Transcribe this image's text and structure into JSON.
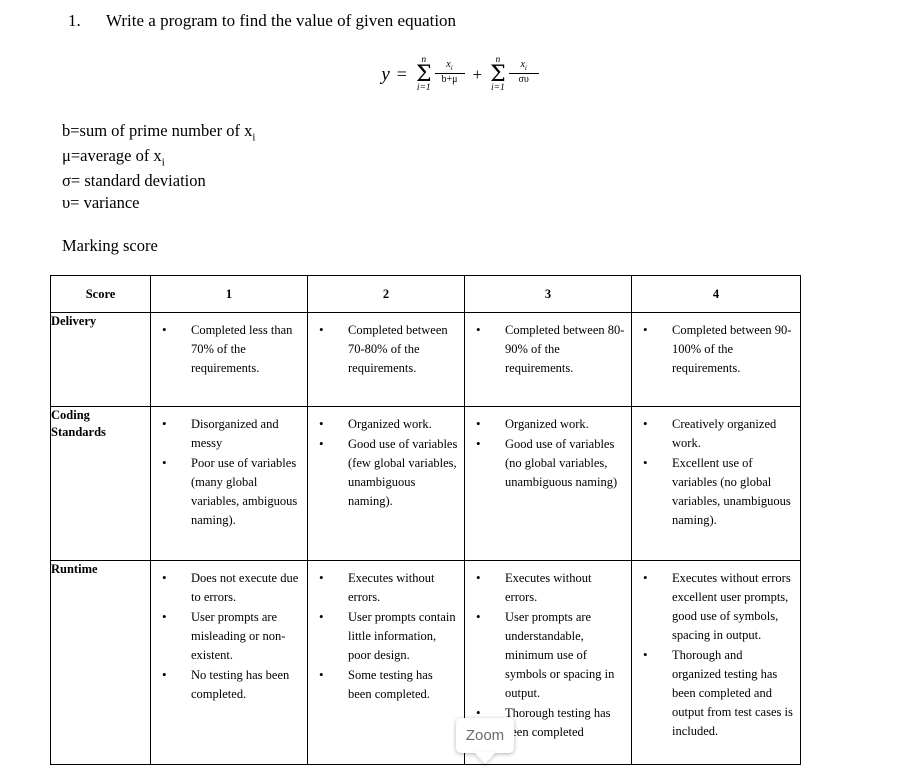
{
  "question": {
    "number": "1.",
    "text": "Write a program to find the value of given equation"
  },
  "equation": {
    "lhs": "y",
    "equals": "=",
    "plus": "+",
    "term1": {
      "sum_upper": "n",
      "sum_symbol": "Σ",
      "sum_lower": "i=1",
      "numerator": "x",
      "numerator_sub": "i",
      "denominator": "b+μ"
    },
    "term2": {
      "sum_upper": "n",
      "sum_symbol": "Σ",
      "sum_lower": "i=1",
      "numerator": "x",
      "numerator_sub": "i",
      "denominator": "συ"
    }
  },
  "definitions": [
    {
      "prefix": "b=sum of prime number of x",
      "sub": "i"
    },
    {
      "prefix": "μ=average of x",
      "sub": "i"
    },
    {
      "prefix": "σ= standard deviation",
      "sub": ""
    },
    {
      "prefix": "υ= variance",
      "sub": ""
    }
  ],
  "marking_score_label": "Marking score",
  "table": {
    "headers": [
      "Score",
      "1",
      "2",
      "3",
      "4"
    ],
    "rows": [
      {
        "criterion": [
          "Delivery"
        ],
        "levels": [
          [
            "Completed less than 70% of the requirements."
          ],
          [
            "Completed between 70-80% of the requirements."
          ],
          [
            "Completed between 80-90% of the requirements."
          ],
          [
            "Completed between 90-100% of the requirements."
          ]
        ]
      },
      {
        "criterion": [
          "Coding",
          "Standards"
        ],
        "levels": [
          [
            "Disorganized and messy",
            "Poor use of variables (many global variables, ambiguous naming)."
          ],
          [
            "Organized work.",
            "Good  use of variables (few global variables, unambiguous naming)."
          ],
          [
            "Organized work.",
            "Good  use of variables (no global variables, unambiguous naming)"
          ],
          [
            "Creatively organized work.",
            "Excellent  use of variables (no global variables, unambiguous naming)."
          ]
        ]
      },
      {
        "criterion": [
          "Runtime"
        ],
        "levels": [
          [
            "Does not execute due to errors.",
            "User prompts are misleading or non-existent.",
            "No testing has been completed."
          ],
          [
            "Executes without errors.",
            "User prompts contain little information, poor design.",
            "Some testing has been completed."
          ],
          [
            "Executes without errors.",
            "User prompts are understandable, minimum use of symbols or spacing in output.",
            "Thorough testing has been completed"
          ],
          [
            "Executes without errors excellent user prompts, good use of symbols, spacing in output.",
            "Thorough and organized testing has been completed and output from test cases is included."
          ]
        ]
      }
    ]
  },
  "zoom_tooltip": {
    "label": "Zoom"
  }
}
